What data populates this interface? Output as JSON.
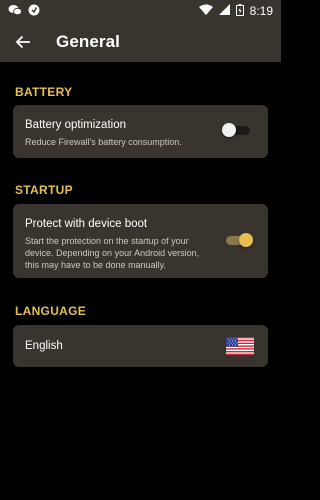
{
  "statusbar": {
    "time": "8:19"
  },
  "appbar": {
    "title": "General"
  },
  "battery": {
    "section_title": "BATTERY",
    "title": "Battery optimization",
    "description": "Reduce Firewall's battery consumption.",
    "toggle_on": false
  },
  "startup": {
    "section_title": "STARTUP",
    "title": "Protect with device boot",
    "description_lines": [
      "Start the protection on the startup of your",
      "device. Depending on your Android version,",
      "this may have to be done manually."
    ],
    "toggle_on": true
  },
  "language": {
    "section_title": "LANGUAGE",
    "current": "English",
    "flag_icon": "us-flag-icon"
  },
  "colors": {
    "accent": "#e6be52",
    "surface": "#3a342f",
    "background": "#000000"
  }
}
